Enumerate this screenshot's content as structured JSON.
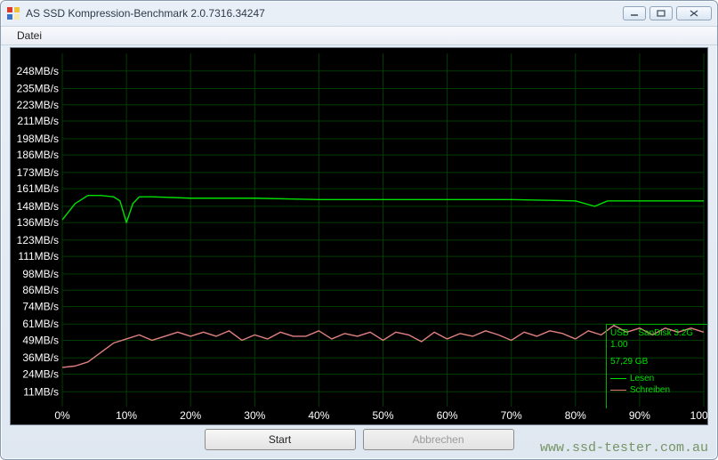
{
  "window": {
    "title": "AS SSD Kompression-Benchmark 2.0.7316.34247"
  },
  "menu": {
    "file": "Datei"
  },
  "buttons": {
    "start": "Start",
    "abort": "Abbrechen"
  },
  "watermark": "www.ssd-tester.com.au",
  "info": {
    "interface": "USB",
    "device": "SanDisk 3.2G",
    "firmware": "1.00",
    "capacity": "57,29 GB",
    "legend_read": "Lesen",
    "legend_write": "Schreiben"
  },
  "chart_data": {
    "type": "line",
    "title": "",
    "xlabel": "",
    "ylabel": "",
    "xlim": [
      0,
      100
    ],
    "x_unit": "%",
    "y_unit": "MB/s",
    "y_ticks": [
      11,
      24,
      36,
      49,
      61,
      74,
      86,
      98,
      111,
      123,
      136,
      148,
      161,
      173,
      186,
      198,
      211,
      223,
      235,
      248
    ],
    "x_ticks": [
      0,
      10,
      20,
      30,
      40,
      50,
      60,
      70,
      80,
      90,
      100
    ],
    "series": [
      {
        "name": "Lesen",
        "color": "#00e000",
        "x": [
          0,
          2,
          4,
          6,
          8,
          9,
          10,
          11,
          12,
          14,
          20,
          30,
          40,
          50,
          60,
          70,
          80,
          83,
          85,
          90,
          100
        ],
        "values": [
          138,
          150,
          156,
          156,
          155,
          152,
          136,
          150,
          155,
          155,
          154,
          154,
          153,
          153,
          153,
          153,
          152,
          148,
          152,
          152,
          152
        ]
      },
      {
        "name": "Schreiben",
        "color": "#e08080",
        "x": [
          0,
          2,
          4,
          6,
          8,
          10,
          12,
          14,
          16,
          18,
          20,
          22,
          24,
          26,
          28,
          30,
          32,
          34,
          36,
          38,
          40,
          42,
          44,
          46,
          48,
          50,
          52,
          54,
          56,
          58,
          60,
          62,
          64,
          66,
          68,
          70,
          72,
          74,
          76,
          78,
          80,
          82,
          84,
          86,
          88,
          90,
          92,
          94,
          96,
          98,
          100
        ],
        "values": [
          29,
          30,
          33,
          40,
          47,
          50,
          53,
          49,
          52,
          55,
          52,
          55,
          52,
          56,
          49,
          53,
          50,
          55,
          52,
          52,
          56,
          50,
          54,
          52,
          55,
          49,
          55,
          53,
          48,
          55,
          50,
          54,
          52,
          56,
          53,
          49,
          55,
          52,
          56,
          54,
          50,
          56,
          53,
          60,
          55,
          58,
          53,
          58,
          55,
          58,
          55
        ]
      }
    ]
  }
}
